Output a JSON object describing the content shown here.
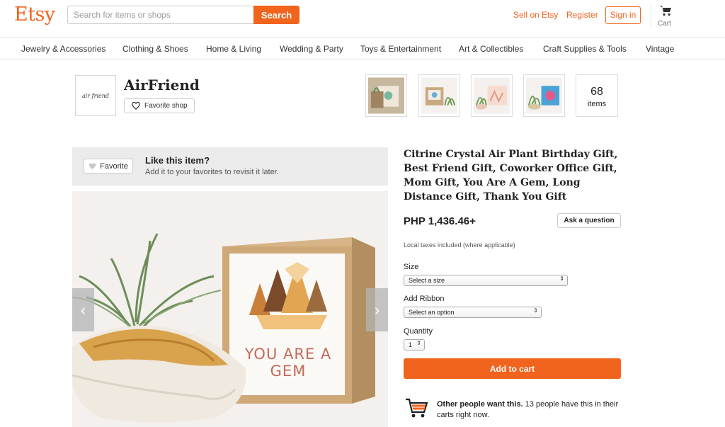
{
  "header": {
    "logo": "Etsy",
    "search_placeholder": "Search for items or shops",
    "search_button": "Search",
    "sell_link": "Sell on Etsy",
    "register_link": "Register",
    "signin_button": "Sign in",
    "cart_label": "Cart"
  },
  "categories": [
    "Jewelry & Accessories",
    "Clothing & Shoes",
    "Home & Living",
    "Wedding & Party",
    "Toys & Entertainment",
    "Art & Collectibles",
    "Craft Supplies & Tools",
    "Vintage"
  ],
  "shop": {
    "logo_text": "air friend",
    "name": "AirFriend",
    "favorite_button": "Favorite shop",
    "items_count": "68",
    "items_label": "items",
    "thumb_icons": [
      "gift-box-thumbnail",
      "plant-box-thumbnail",
      "plant-card-thumbnail",
      "plant-card-blue-thumbnail"
    ]
  },
  "favorite_banner": {
    "button": "Favorite",
    "title": "Like this item?",
    "subtitle": "Add it to your favorites to revisit it later."
  },
  "hero": {
    "box_text": "YOU ARE A GEM",
    "prev_arrow": "‹",
    "next_arrow": "›"
  },
  "product": {
    "title": "Citrine Crystal Air Plant Birthday Gift, Best Friend Gift, Coworker Office Gift, Mom Gift, You Are A Gem, Long Distance Gift, Thank You Gift",
    "price": "PHP 1,436.46+",
    "ask_button": "Ask a question",
    "taxes_note": "Local taxes included (where applicable)",
    "size_label": "Size",
    "size_value": "Select a size",
    "ribbon_label": "Add Ribbon",
    "ribbon_value": "Select an option",
    "quantity_label": "Quantity",
    "quantity_value": "1",
    "add_to_cart": "Add to cart",
    "demand_bold": "Other people want this.",
    "demand_text": " 13 people have this in their carts right now."
  },
  "colors": {
    "brand": "#f1641e",
    "banner_bg": "#ebebeb"
  }
}
